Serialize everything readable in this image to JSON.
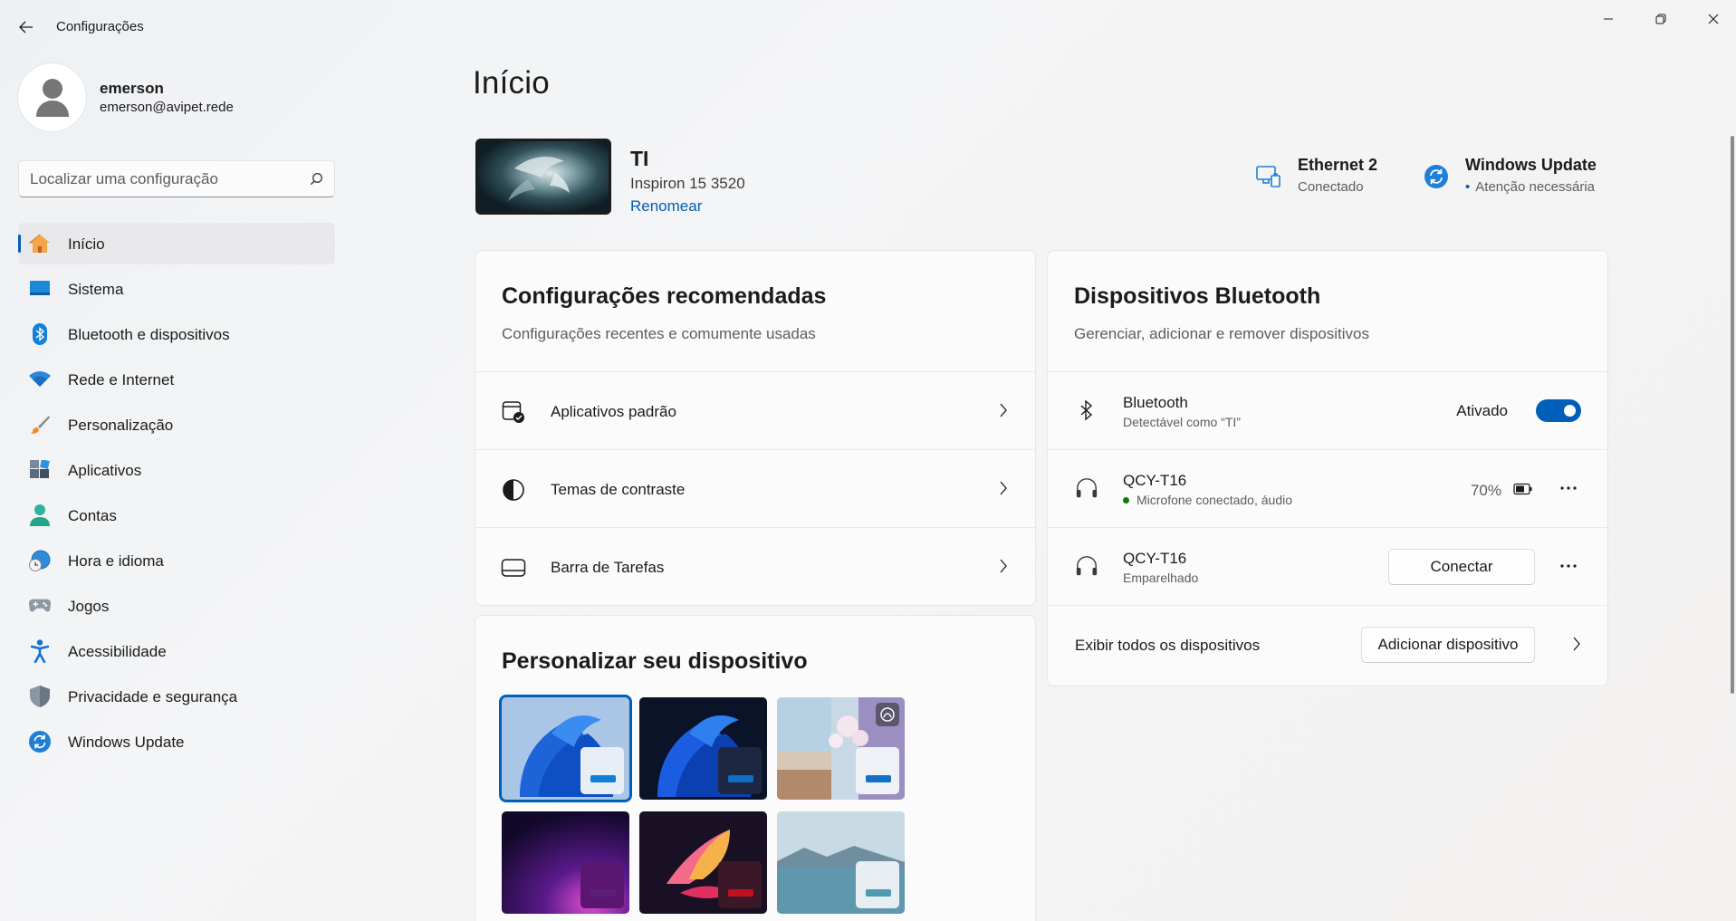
{
  "window": {
    "title": "Configurações",
    "controls": [
      "minimize-icon",
      "restore-icon",
      "close-icon"
    ]
  },
  "profile": {
    "name": "emerson",
    "email": "emerson@avipet.rede"
  },
  "search": {
    "placeholder": "Localizar uma configuração"
  },
  "sidebar": {
    "items": [
      {
        "label": "Início",
        "icon": "home-icon",
        "active": true
      },
      {
        "label": "Sistema",
        "icon": "system-icon"
      },
      {
        "label": "Bluetooth e dispositivos",
        "icon": "bluetooth-icon"
      },
      {
        "label": "Rede e Internet",
        "icon": "wifi-icon"
      },
      {
        "label": "Personalização",
        "icon": "brush-icon"
      },
      {
        "label": "Aplicativos",
        "icon": "apps-icon"
      },
      {
        "label": "Contas",
        "icon": "accounts-icon"
      },
      {
        "label": "Hora e idioma",
        "icon": "globe-clock-icon"
      },
      {
        "label": "Jogos",
        "icon": "gamepad-icon"
      },
      {
        "label": "Acessibilidade",
        "icon": "accessibility-icon"
      },
      {
        "label": "Privacidade e segurança",
        "icon": "shield-icon"
      },
      {
        "label": "Windows Update",
        "icon": "update-icon"
      }
    ]
  },
  "main": {
    "title": "Início",
    "device": {
      "name": "TI",
      "model": "Inspiron 15 3520",
      "rename_label": "Renomear"
    },
    "status": {
      "network": {
        "title": "Ethernet 2",
        "subtitle": "Conectado",
        "icon": "ethernet-icon"
      },
      "update": {
        "title": "Windows Update",
        "subtitle": "Atenção necessária",
        "icon": "update-icon"
      }
    },
    "recommended": {
      "title": "Configurações recomendadas",
      "subtitle": "Configurações recentes e comumente usadas",
      "items": [
        {
          "label": "Aplicativos padrão",
          "icon": "default-apps-icon"
        },
        {
          "label": "Temas de contraste",
          "icon": "contrast-icon"
        },
        {
          "label": "Barra de Tarefas",
          "icon": "taskbar-icon"
        }
      ]
    },
    "personalize": {
      "title": "Personalizar seu dispositivo",
      "accent_colors": [
        "#0f7fd6",
        "#0f6ec4",
        "#1670c9",
        "#5b1f7a",
        "#c4101e",
        "#4e9bb0"
      ]
    },
    "bluetooth": {
      "title": "Dispositivos Bluetooth",
      "subtitle": "Gerenciar, adicionar e remover dispositivos",
      "toggle": {
        "title": "Bluetooth",
        "subtitle": "Detectável como “TI”",
        "state_label": "Ativado",
        "on": true
      },
      "devices": [
        {
          "name": "QCY-T16",
          "status": "Microfone conectado, áudio",
          "battery": "70%",
          "connected": true
        },
        {
          "name": "QCY-T16",
          "status": "Emparelhado",
          "action": "Conectar",
          "connected": false
        }
      ],
      "footer": {
        "label": "Exibir todos os dispositivos",
        "button": "Adicionar dispositivo"
      }
    }
  },
  "colors": {
    "accent": "#005fb8",
    "status_ok": "#0f7b0f"
  }
}
